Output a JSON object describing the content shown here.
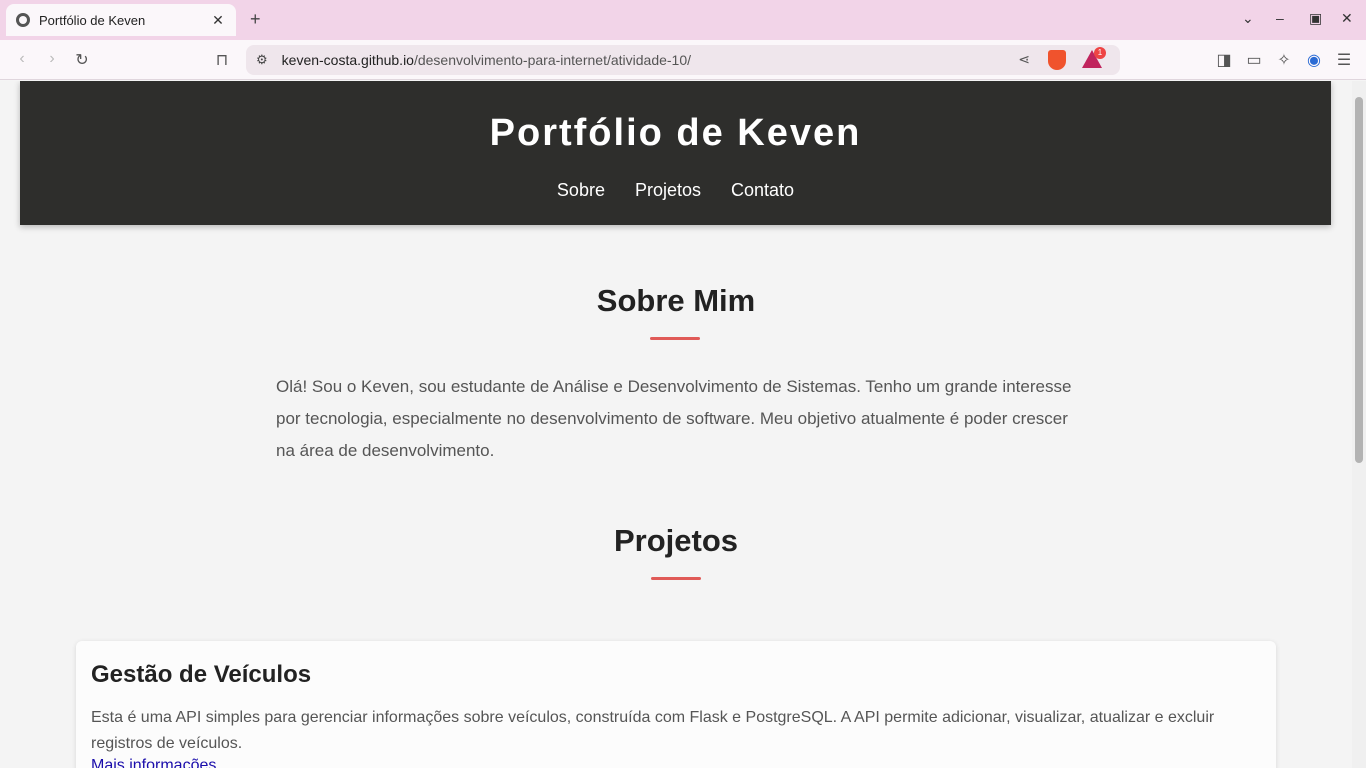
{
  "browser": {
    "tab_title": "Portfólio de Keven",
    "tab_close": "✕",
    "new_tab": "+",
    "url_host": "keven-costa.github.io",
    "url_path": "/desenvolvimento-para-internet/atividade-10/",
    "rewards_badge": "1"
  },
  "header": {
    "title": "Portfólio de Keven",
    "nav": [
      "Sobre",
      "Projetos",
      "Contato"
    ]
  },
  "about": {
    "title": "Sobre Mim",
    "text": "Olá! Sou o Keven, sou estudante de Análise e Desenvolvimento de Sistemas. Tenho um grande interesse por tecnologia, especialmente no desenvolvimento de software. Meu objetivo atualmente é poder crescer na área de desenvolvimento."
  },
  "projects": {
    "title": "Projetos",
    "items": [
      {
        "name": "Gestão de Veículos",
        "description": "Esta é uma API simples para gerenciar informações sobre veículos, construída com Flask e PostgreSQL. A API permite adicionar, visualizar, atualizar e excluir registros de veículos.",
        "link": "Mais informações"
      }
    ]
  },
  "colors": {
    "header_bg": "#2e2e2c",
    "accent": "#e05a57",
    "tab_strip": "#f2d4e8"
  }
}
